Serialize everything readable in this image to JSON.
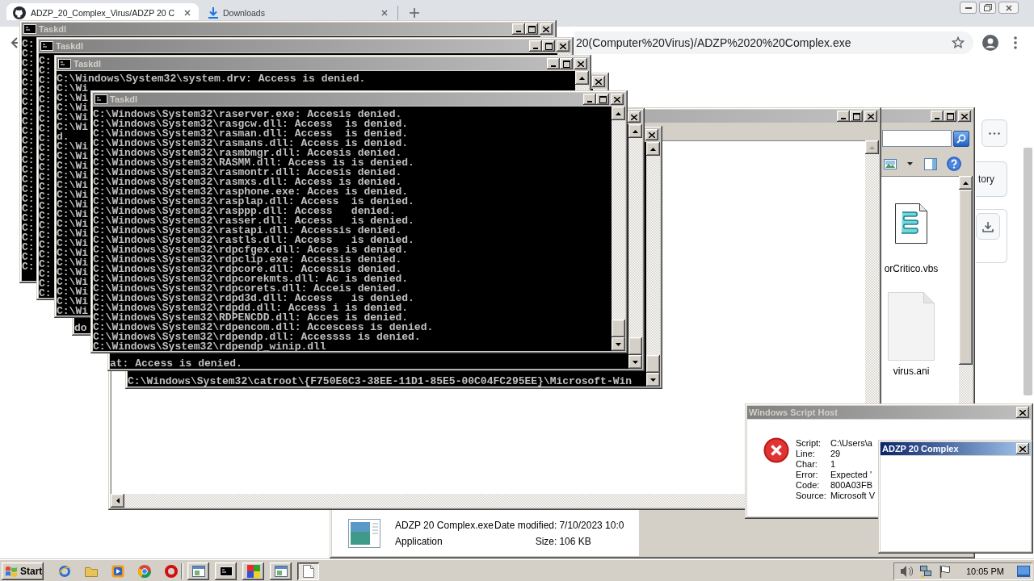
{
  "browser": {
    "tabs": [
      {
        "title": "ADZP_20_Complex_Virus/ADZP 20 C",
        "kind": "site",
        "selected": true
      },
      {
        "title": "Downloads",
        "kind": "downloads",
        "selected": false
      }
    ],
    "url": "20(Computer%20Virus)/ADZP%2020%20Complex.exe",
    "page_button_label": "tory"
  },
  "consoles": [
    {
      "title": "Taskdl",
      "lines": [
        "C:",
        "C:",
        "C:",
        "C:",
        "C:",
        "C:",
        "C:",
        "C:",
        "C:",
        "C:",
        "C:",
        "C:",
        "C:",
        "C:",
        "C:",
        "C:",
        "C:",
        "C:",
        "C:",
        "C:",
        "C:",
        "C:",
        "C:",
        "C:"
      ]
    },
    {
      "title": "Taskdl",
      "lines": [
        "C:",
        "C:",
        "C:",
        "C:",
        "C:",
        "C:",
        "C:",
        "C:",
        "C:",
        "C:",
        "C:",
        "C:",
        "C:",
        "C:",
        "C:",
        "C:",
        "C:",
        "C:",
        "C:",
        "C:",
        "C:",
        "C:",
        "C:",
        "C:",
        "C:"
      ]
    },
    {
      "title": "Taskdl",
      "lines": [
        "C:\\Windows\\System32\\system.drv: Access is denied.",
        "C:\\Wi",
        "C:\\Wi",
        "C:\\Wi",
        "C:\\Wi",
        "C:\\Wi",
        "d.",
        "C:\\Wi",
        "C:\\Wi",
        "C:\\Wi",
        "C:\\Wi",
        "C:\\Wi",
        "C:\\Wi",
        "C:\\Wi",
        "C:\\Wi",
        "C:\\Wi",
        "C:\\Wi",
        "C:\\Wi",
        "C:\\Wi",
        "C:\\Wi",
        "C:\\Wi",
        "C:\\Wi",
        "C:\\Wi",
        "C:\\Wi",
        "C:\\Wi"
      ]
    },
    {
      "title": "Taskdl",
      "lines": [
        "C:\\Windows\\System32\\raserver.exe: Accesis denied.",
        "C:\\Windows\\System32\\rasgcw.dll: Access  is denied.",
        "C:\\Windows\\System32\\rasman.dll: Access  is denied.",
        "C:\\Windows\\System32\\rasmans.dll: Access is denied.",
        "C:\\Windows\\System32\\rasmbmgr.dll: Accesis denied.",
        "C:\\Windows\\System32\\RASMM.dll: Access is is denied.",
        "C:\\Windows\\System32\\rasmontr.dll: Accesis denied.",
        "C:\\Windows\\System32\\rasmxs.dll: Access is denied.",
        "C:\\Windows\\System32\\rasphone.exe: Acces is denied.",
        "C:\\Windows\\System32\\rasplap.dll: Access  is denied.",
        "C:\\Windows\\System32\\rasppp.dll: Access   denied.",
        "C:\\Windows\\System32\\rasser.dll: Access   is denied.",
        "C:\\Windows\\System32\\rastapi.dll: Accessis denied.",
        "C:\\Windows\\System32\\rastls.dll: Access   is denied.",
        "C:\\Windows\\System32\\rdpcfgex.dll: Acces is denied.",
        "C:\\Windows\\System32\\rdpclip.exe: Accessis denied.",
        "C:\\Windows\\System32\\rdpcore.dll: Accessis denied.",
        "C:\\Windows\\System32\\rdpcorekmts.dll: Ac is denied.",
        "C:\\Windows\\System32\\rdpcorets.dll: Acceis denied.",
        "C:\\Windows\\System32\\rdpd3d.dll: Access   is denied.",
        "C:\\Windows\\System32\\rdpdd.dll: Access i is denied.",
        "C:\\Windows\\System32\\RDPENCDD.dll: Acces is denied.",
        "C:\\Windows\\System32\\rdpencom.dll: Accescess is denied.",
        "C:\\Windows\\System32\\rdpendp.dll: Accessss is denied.",
        "C:\\Windows\\System32\\rdpendp_winip.dll"
      ]
    },
    {
      "lines": [
        "do"
      ]
    },
    {
      "lines": [
        "at: Access is denied."
      ]
    },
    {
      "lines": [
        "C:\\Windows\\System32\\catroot\\{F750E6C3-38EE-11D1-85E5-00C04FC295EE}\\Microsoft-Win"
      ]
    }
  ],
  "explorer": {
    "files": [
      {
        "name": "orCritico.vbs",
        "kind": "script"
      },
      {
        "name": "virus.ani",
        "kind": "blank"
      }
    ],
    "details": {
      "file_name": "ADZP 20 Complex.exe",
      "type": "Application",
      "fields": [
        {
          "label": "Date modified:",
          "value": "7/10/2023 10:0"
        },
        {
          "label": "Size:",
          "value": "106 KB"
        }
      ]
    }
  },
  "script_error": {
    "title": "Windows Script Host",
    "active": false,
    "fields": [
      {
        "label": "Script:",
        "value": "C:\\Users\\a"
      },
      {
        "label": "Line:",
        "value": "29"
      },
      {
        "label": "Char:",
        "value": "1"
      },
      {
        "label": "Error:",
        "value": "Expected '"
      },
      {
        "label": "Code:",
        "value": "800A03FB"
      },
      {
        "label": "Source:",
        "value": "Microsoft V"
      }
    ]
  },
  "app_dialog": {
    "title": "ADZP 20 Complex",
    "active": true
  },
  "taskbar": {
    "start": "Start",
    "tasks": [
      {
        "kind": "window",
        "selected": false
      },
      {
        "kind": "console",
        "selected": false
      },
      {
        "kind": "blocks",
        "selected": false
      },
      {
        "kind": "window",
        "selected": false
      },
      {
        "kind": "document",
        "selected": true
      }
    ],
    "clock": "10:05 PM"
  }
}
